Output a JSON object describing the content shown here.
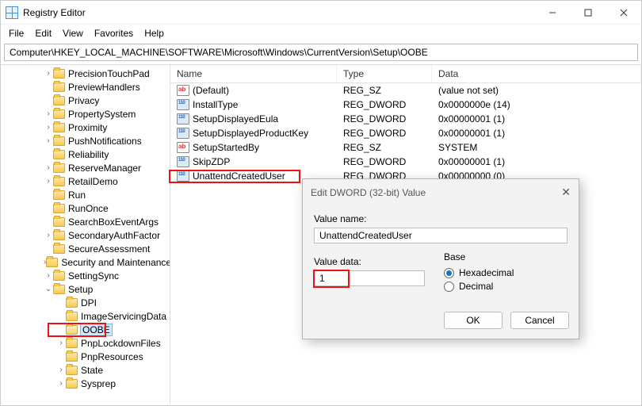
{
  "window": {
    "title": "Registry Editor",
    "buttons": {
      "min": "min",
      "max": "max",
      "close": "close"
    }
  },
  "menubar": [
    "File",
    "Edit",
    "View",
    "Favorites",
    "Help"
  ],
  "address": "Computer\\HKEY_LOCAL_MACHINE\\SOFTWARE\\Microsoft\\Windows\\CurrentVersion\\Setup\\OOBE",
  "tree": [
    {
      "indent": 3,
      "label": "PrecisionTouchPad",
      "exp": ">"
    },
    {
      "indent": 3,
      "label": "PreviewHandlers",
      "exp": ""
    },
    {
      "indent": 3,
      "label": "Privacy",
      "exp": ""
    },
    {
      "indent": 3,
      "label": "PropertySystem",
      "exp": ">"
    },
    {
      "indent": 3,
      "label": "Proximity",
      "exp": ">"
    },
    {
      "indent": 3,
      "label": "PushNotifications",
      "exp": ">"
    },
    {
      "indent": 3,
      "label": "Reliability",
      "exp": ""
    },
    {
      "indent": 3,
      "label": "ReserveManager",
      "exp": ">"
    },
    {
      "indent": 3,
      "label": "RetailDemo",
      "exp": ">"
    },
    {
      "indent": 3,
      "label": "Run",
      "exp": ""
    },
    {
      "indent": 3,
      "label": "RunOnce",
      "exp": ""
    },
    {
      "indent": 3,
      "label": "SearchBoxEventArgs",
      "exp": ""
    },
    {
      "indent": 3,
      "label": "SecondaryAuthFactor",
      "exp": ">"
    },
    {
      "indent": 3,
      "label": "SecureAssessment",
      "exp": ""
    },
    {
      "indent": 3,
      "label": "Security and Maintenance",
      "exp": ">"
    },
    {
      "indent": 3,
      "label": "SettingSync",
      "exp": ">"
    },
    {
      "indent": 3,
      "label": "Setup",
      "exp": "v"
    },
    {
      "indent": 4,
      "label": "DPI",
      "exp": ""
    },
    {
      "indent": 4,
      "label": "ImageServicingData",
      "exp": ""
    },
    {
      "indent": 4,
      "label": "OOBE",
      "exp": "",
      "selected": true,
      "redbox": true
    },
    {
      "indent": 4,
      "label": "PnpLockdownFiles",
      "exp": ">"
    },
    {
      "indent": 4,
      "label": "PnpResources",
      "exp": ""
    },
    {
      "indent": 4,
      "label": "State",
      "exp": ">"
    },
    {
      "indent": 4,
      "label": "Sysprep",
      "exp": ">"
    }
  ],
  "columns": {
    "name": "Name",
    "type": "Type",
    "data": "Data"
  },
  "values": [
    {
      "icon": "sz",
      "name": "(Default)",
      "type": "REG_SZ",
      "data": "(value not set)"
    },
    {
      "icon": "dw",
      "name": "InstallType",
      "type": "REG_DWORD",
      "data": "0x0000000e (14)"
    },
    {
      "icon": "dw",
      "name": "SetupDisplayedEula",
      "type": "REG_DWORD",
      "data": "0x00000001 (1)"
    },
    {
      "icon": "dw",
      "name": "SetupDisplayedProductKey",
      "type": "REG_DWORD",
      "data": "0x00000001 (1)"
    },
    {
      "icon": "sz",
      "name": "SetupStartedBy",
      "type": "REG_SZ",
      "data": "SYSTEM"
    },
    {
      "icon": "dw",
      "name": "SkipZDP",
      "type": "REG_DWORD",
      "data": "0x00000001 (1)"
    },
    {
      "icon": "dw",
      "name": "UnattendCreatedUser",
      "type": "REG_DWORD",
      "data": "0x00000000 (0)",
      "redbox": true
    }
  ],
  "dialog": {
    "title": "Edit DWORD (32-bit) Value",
    "valueNameLabel": "Value name:",
    "valueName": "UnattendCreatedUser",
    "valueDataLabel": "Value data:",
    "valueData": "1",
    "baseLabel": "Base",
    "radioHex": "Hexadecimal",
    "radioDec": "Decimal",
    "ok": "OK",
    "cancel": "Cancel"
  }
}
